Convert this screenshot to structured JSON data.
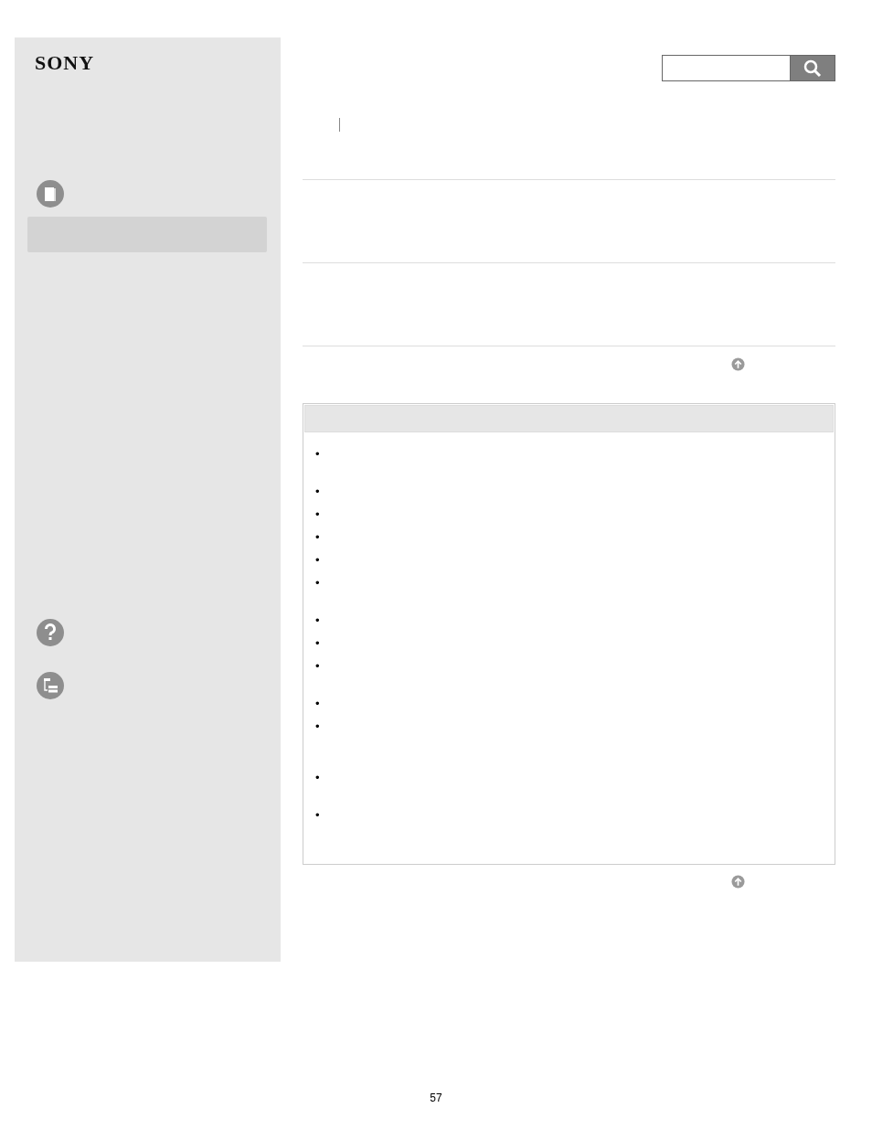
{
  "sidebar": {
    "logo": "SONY",
    "nav_items": [
      {
        "selected": true
      }
    ]
  },
  "notes": [
    {
      "marker": "•",
      "kind": "two-line"
    },
    {
      "marker": "•",
      "kind": "one-line"
    },
    {
      "marker": "•",
      "kind": "one-line"
    },
    {
      "marker": "•",
      "kind": "one-line"
    },
    {
      "marker": "•",
      "kind": "one-line"
    },
    {
      "marker": "•",
      "kind": "two-line"
    },
    {
      "marker": "•",
      "kind": "one-line"
    },
    {
      "marker": "•",
      "kind": "one-line"
    },
    {
      "marker": "•",
      "kind": "two-line"
    },
    {
      "marker": "•",
      "kind": "one-line"
    },
    {
      "marker": "•",
      "kind": "three-line"
    },
    {
      "marker": "•",
      "kind": "two-line"
    },
    {
      "marker": "•",
      "kind": "two-line"
    }
  ],
  "page_number": "57"
}
